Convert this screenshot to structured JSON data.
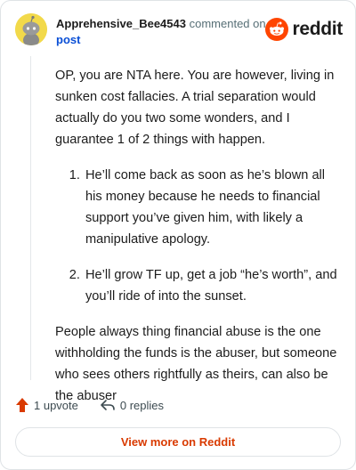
{
  "header": {
    "username": "Apprehensive_Bee4543",
    "action_text": "commented on",
    "post_link": "post",
    "brand_word": "reddit"
  },
  "comment": {
    "paragraph1": "OP, you are NTA here. You are however, living in sunken cost fallacies. A trial separation would actually do you two some wonders, and I guarantee 1 of 2 things with happen.",
    "list_items": [
      "He’ll come back as soon as he’s blown all his money because he needs to financial support you’ve given him, with likely a manipulative apology.",
      "He’ll grow TF up, get a job “he’s worth”, and you’ll ride of into the sunset."
    ],
    "paragraph2": "People always thing financial abuse is the one withholding the funds is the abuser, but someone who sees others rightfully as theirs, can also be the abuser"
  },
  "actions": {
    "upvote_label": "1 upvote",
    "replies_label": "0 replies"
  },
  "footer": {
    "view_more_label": "View more on Reddit"
  },
  "colors": {
    "brand": "#ff4500",
    "upvote": "#d93a00",
    "link": "#0a4fd6"
  },
  "icons": [
    "snoo-avatar-icon",
    "reddit-logo-icon",
    "upvote-arrow-icon",
    "reply-arrow-icon"
  ]
}
